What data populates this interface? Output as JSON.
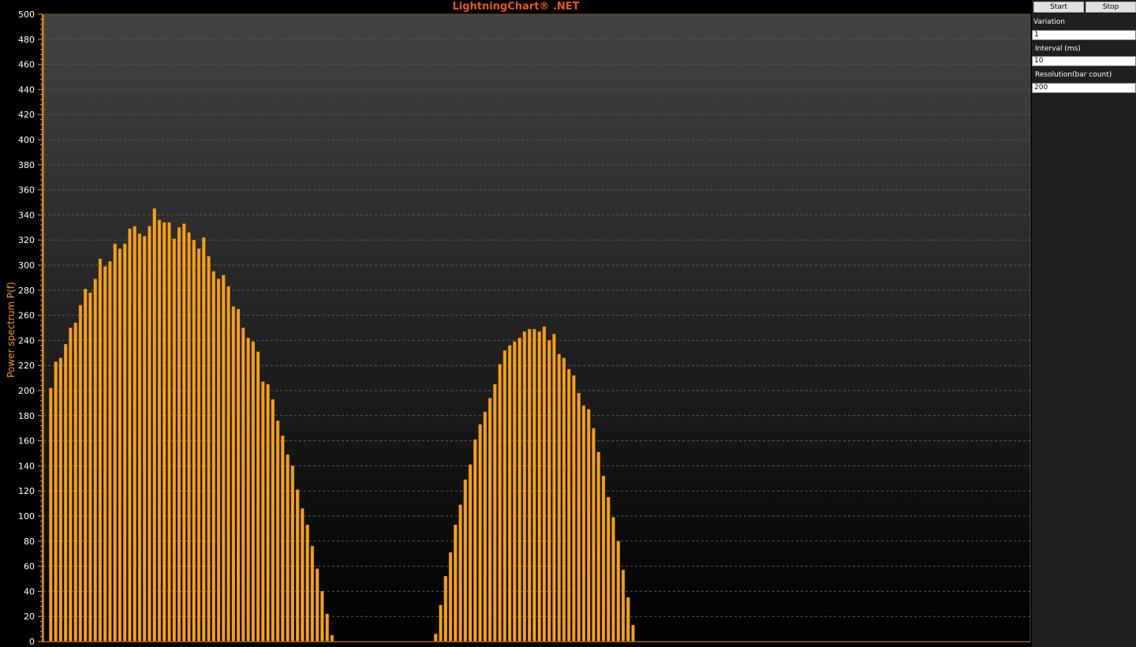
{
  "chart_data": {
    "type": "bar",
    "title": "LightningChart® .NET",
    "xlabel": "",
    "ylabel": "Power spectrum P(f)",
    "ylim": [
      0,
      500
    ],
    "yticks": [
      0,
      20,
      40,
      60,
      80,
      100,
      120,
      140,
      160,
      180,
      200,
      220,
      240,
      260,
      280,
      300,
      320,
      340,
      360,
      380,
      400,
      420,
      440,
      460,
      480,
      500
    ],
    "grid": true,
    "bar_count": 200,
    "values": [
      0,
      202,
      223,
      226,
      237,
      250,
      254,
      268,
      281,
      278,
      289,
      305,
      299,
      303,
      317,
      313,
      317,
      329,
      331,
      325,
      323,
      331,
      345,
      336,
      334,
      334,
      321,
      330,
      333,
      326,
      320,
      313,
      322,
      307,
      295,
      289,
      292,
      283,
      267,
      265,
      250,
      242,
      239,
      231,
      207,
      205,
      193,
      176,
      164,
      149,
      140,
      121,
      106,
      93,
      76,
      58,
      40,
      22,
      5,
      0,
      0,
      0,
      0,
      0,
      0,
      0,
      0,
      0,
      0,
      0,
      0,
      0,
      0,
      0,
      0,
      0,
      0,
      0,
      0,
      6,
      29,
      52,
      71,
      93,
      109,
      129,
      141,
      161,
      173,
      183,
      194,
      205,
      221,
      232,
      236,
      239,
      242,
      247,
      249,
      249,
      247,
      251,
      240,
      245,
      229,
      226,
      217,
      212,
      198,
      188,
      185,
      170,
      151,
      132,
      115,
      99,
      80,
      57,
      35,
      13,
      0,
      0,
      0,
      0,
      0,
      0,
      0,
      0,
      0,
      0,
      0,
      0,
      0,
      0,
      0,
      0,
      0,
      0,
      0,
      0,
      0,
      0,
      0,
      0,
      0,
      0,
      0,
      0,
      0,
      0,
      0,
      0,
      0,
      0,
      0,
      0,
      0,
      0,
      0,
      0,
      0,
      0,
      0,
      0,
      0,
      0,
      0,
      0,
      0,
      0,
      0,
      0,
      0,
      0,
      0,
      0,
      0,
      0,
      0,
      0,
      0,
      0,
      0,
      0,
      0,
      0,
      0,
      0,
      0,
      0,
      0,
      0,
      0,
      0,
      0,
      0,
      0,
      0,
      0,
      0,
      0,
      0,
      0
    ]
  },
  "colors": {
    "bar": "#f5a215",
    "bar_edge": "#b46f08",
    "axis": "#f09a20",
    "title": "#e8581c",
    "grid": "#5a5a5a",
    "tick_text": "#ffffff",
    "bg_top": "#444444",
    "bg_bottom": "#000000"
  },
  "controls": {
    "start_label": "Start",
    "stop_label": "Stop",
    "variation_label": "Variation",
    "variation_value": "1",
    "interval_label": "Interval (ms)",
    "interval_value": "10",
    "resolution_label": "Resolution(bar count)",
    "resolution_value": "200"
  }
}
